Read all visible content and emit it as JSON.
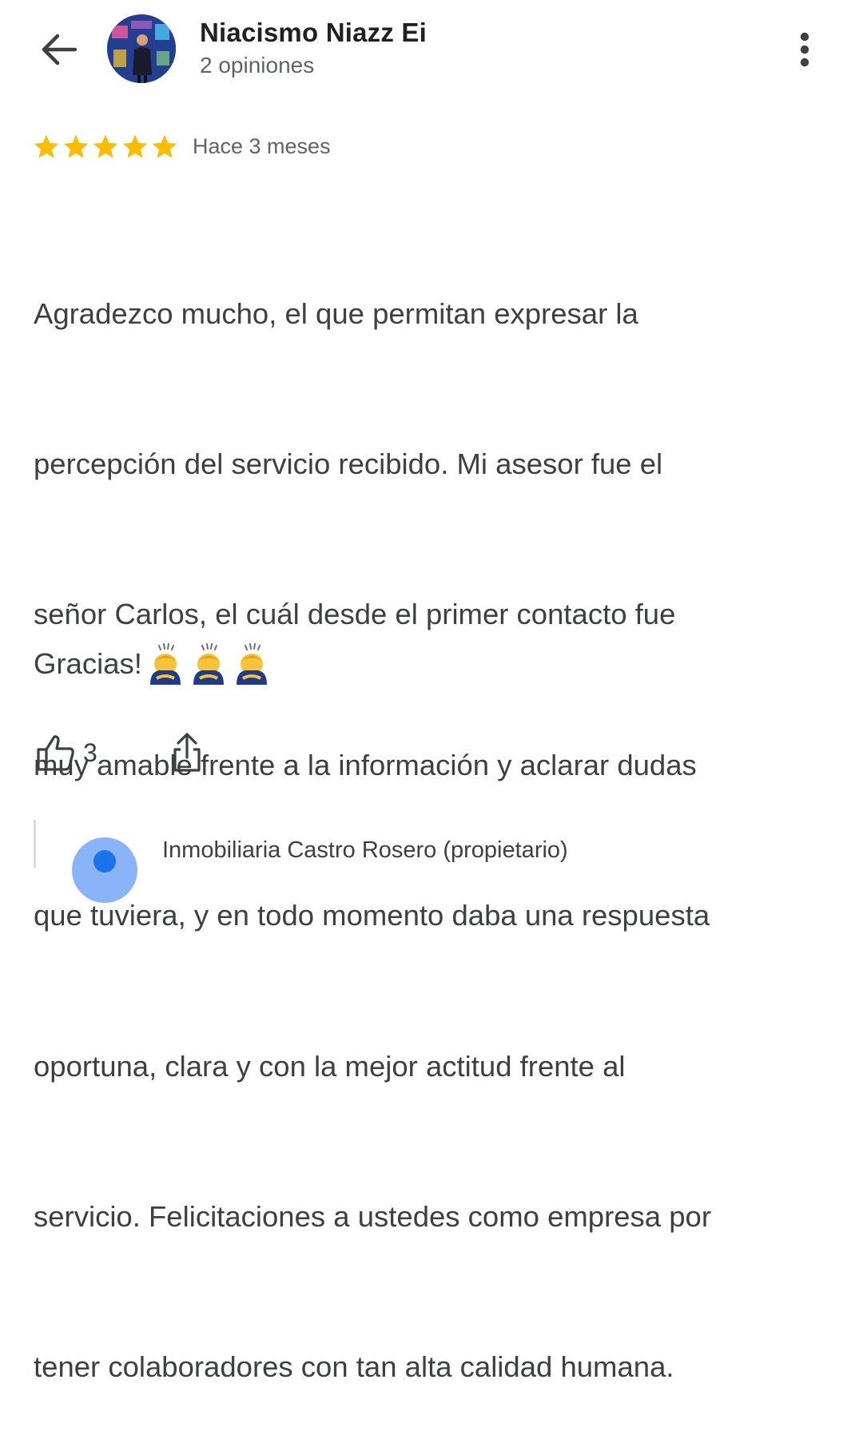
{
  "header": {
    "back_icon": "arrow-back-icon",
    "author_name": "Niacismo Niazz Ei",
    "author_reviews": "2 opiniones",
    "menu_icon": "more-vert-icon"
  },
  "review": {
    "rating": 5,
    "max_rating": 5,
    "star_color": "#fbbc04",
    "time": "Hace 3 meses",
    "lines": [
      "Agradezco mucho, el que permitan expresar la",
      "percepción del servicio recibido. Mi asesor fue el",
      "señor Carlos, el cuál desde el primer contacto fue",
      "muy amable frente a la información y aclarar dudas",
      "que tuviera, y en todo momento daba una respuesta",
      "oportuna, clara y con la mejor actitud frente al",
      "servicio. Felicitaciones a ustedes como empresa por",
      "tener colaboradores con tan alta calidad humana."
    ],
    "closing": "Gracias!",
    "closing_emojis": [
      "person-bowing-emoji",
      "person-bowing-emoji",
      "person-bowing-emoji"
    ]
  },
  "actions": {
    "like_icon": "thumb-up-icon",
    "like_count": "3",
    "share_icon": "share-icon"
  },
  "owner_reply": {
    "name": "Inmobiliaria Castro Rosero (propietario)"
  }
}
